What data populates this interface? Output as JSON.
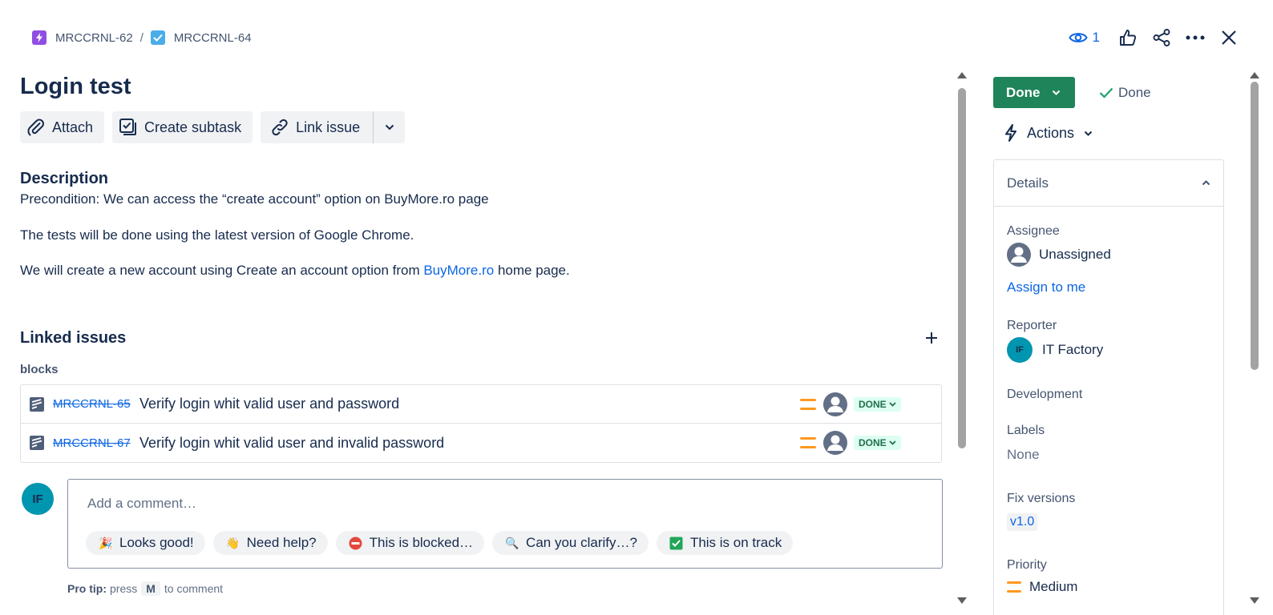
{
  "breadcrumb": {
    "parent_key": "MRCCRNL-62",
    "separator": "/",
    "current_key": "MRCCRNL-64",
    "parent_icon": "epic-lightning-icon",
    "current_icon": "task-check-icon"
  },
  "top_actions": {
    "watch_count": "1",
    "icons": [
      "eye-icon",
      "thumbs-up-icon",
      "share-icon",
      "more-icon",
      "close-icon"
    ]
  },
  "issue": {
    "title": "Login test"
  },
  "toolbar": {
    "attach_label": "Attach",
    "create_subtask_label": "Create subtask",
    "link_issue_label": "Link issue"
  },
  "description": {
    "heading": "Description",
    "p1": "Precondition: We can access the “create account” option on BuyMore.ro  page",
    "p2": "The tests will be done using the latest version of Google Chrome.",
    "p3_before": "We will create a new account using Create an account option from ",
    "p3_link": "BuyMore.ro",
    "p3_after": " home page."
  },
  "linked_issues": {
    "heading": "Linked issues",
    "relation": "blocks",
    "items": [
      {
        "key": "MRCCRNL-65",
        "summary": "Verify login whit valid user and password",
        "status": "DONE",
        "priority": "Medium"
      },
      {
        "key": "MRCCRNL-67",
        "summary": "Verify login whit valid user and invalid password",
        "status": "DONE",
        "priority": "Medium"
      }
    ]
  },
  "comment": {
    "avatar_initials": "IF",
    "placeholder": "Add a comment…",
    "quick_replies": [
      {
        "emoji": "🎉",
        "label": "Looks good!"
      },
      {
        "emoji": "👋",
        "label": "Need help?"
      },
      {
        "emoji": "⛔",
        "label": "This is blocked…"
      },
      {
        "emoji": "🔍",
        "label": "Can you clarify…?"
      },
      {
        "emoji": "✅",
        "label": "This is on track"
      }
    ],
    "protip_label": "Pro tip:",
    "protip_press": "press",
    "protip_key": "M",
    "protip_rest": "to comment"
  },
  "sidebar": {
    "status_label": "Done",
    "resolution_label": "Done",
    "actions_label": "Actions",
    "details_heading": "Details",
    "assignee_label": "Assignee",
    "assignee_value": "Unassigned",
    "assign_to_me": "Assign to me",
    "reporter_label": "Reporter",
    "reporter_initials": "IF",
    "reporter_value": "IT Factory",
    "development_label": "Development",
    "labels_label": "Labels",
    "labels_value": "None",
    "fix_versions_label": "Fix versions",
    "fix_versions_value": "v1.0",
    "priority_label": "Priority",
    "priority_value": "Medium"
  },
  "colors": {
    "accent": "#0c66e4",
    "status_done": "#1f845a",
    "lozenge_done_bg": "#dcfff1",
    "priority_medium": "#ff991f",
    "avatar_if": "#0096b0"
  }
}
